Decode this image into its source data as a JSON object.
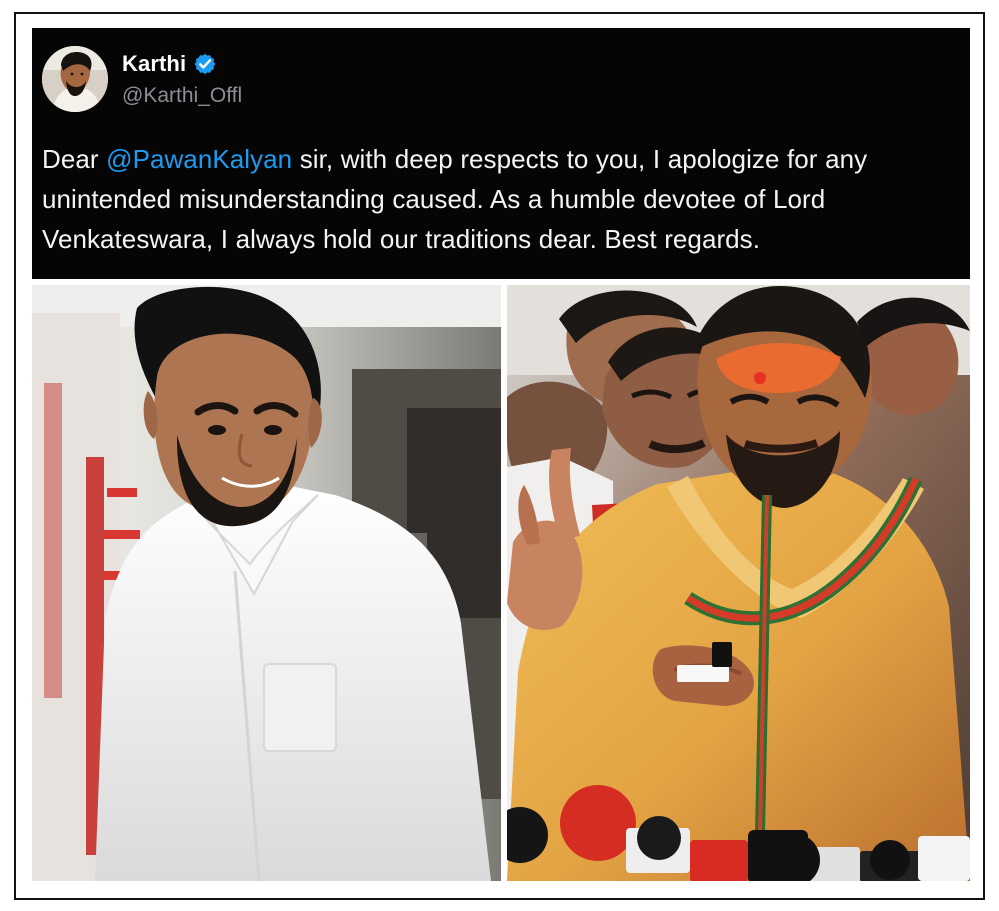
{
  "tweet": {
    "author_name": "Karthi",
    "author_handle": "@Karthi_Offl",
    "verified_badge": "verified-check-icon",
    "text_prefix": "Dear ",
    "mention": "@PawanKalyan",
    "text_suffix": " sir, with deep respects to you, I apologize for any unintended misunderstanding caused. As a humble devotee of Lord Venkateswara, I always hold our traditions dear. Best regards.",
    "colors": {
      "background": "#050505",
      "text": "#f4f4f4",
      "mention": "#1d9bf0",
      "handle": "#8b8f95",
      "verified": "#1d9bf0"
    }
  },
  "photos": {
    "left": {
      "subject": "man in white shirt"
    },
    "right": {
      "subject": "man in saffron attire speaking at microphones"
    }
  },
  "frame": {
    "border_color": "#111111"
  }
}
